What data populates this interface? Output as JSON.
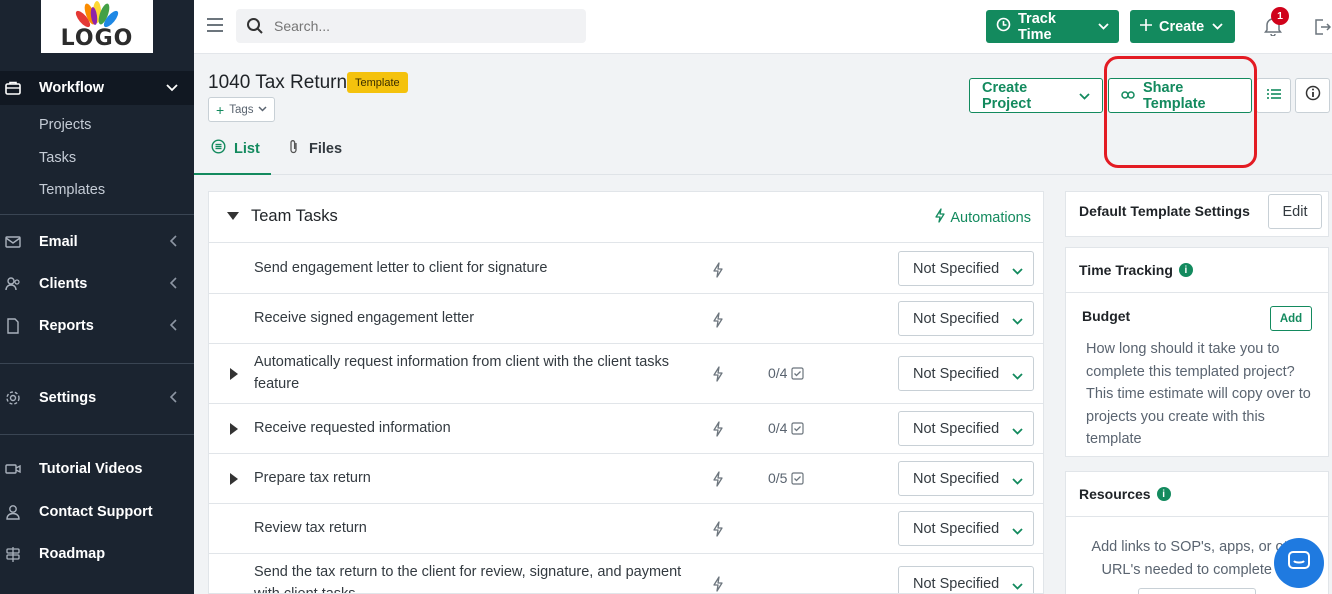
{
  "logo": {
    "text": "LOGO",
    "colors": [
      "#e53935",
      "#fb8c00",
      "#fdd835",
      "#43a047",
      "#1e88e5",
      "#8e24aa"
    ]
  },
  "sidebar": {
    "workflow": {
      "label": "Workflow",
      "icon": "briefcase-icon",
      "sub": [
        "Projects",
        "Tasks",
        "Templates"
      ]
    },
    "email": {
      "label": "Email",
      "icon": "envelope-icon"
    },
    "clients": {
      "label": "Clients",
      "icon": "users-icon"
    },
    "reports": {
      "label": "Reports",
      "icon": "document-icon"
    },
    "settings": {
      "label": "Settings",
      "icon": "gear-icon"
    },
    "tutorials": {
      "label": "Tutorial Videos",
      "icon": "video-icon"
    },
    "support": {
      "label": "Contact Support",
      "icon": "person-icon"
    },
    "roadmap": {
      "label": "Roadmap",
      "icon": "signpost-icon"
    }
  },
  "topbar": {
    "search_placeholder": "Search...",
    "track_time": "Track Time",
    "create": "Create",
    "notification_count": "1"
  },
  "header": {
    "title": "1040 Tax Return",
    "badge": "Template",
    "tags": "Tags",
    "create_project": "Create Project",
    "share_template": "Share Template"
  },
  "tabs": {
    "list": "List",
    "files": "Files"
  },
  "team_tasks": {
    "title": "Team Tasks",
    "automations": "Automations",
    "rows": [
      {
        "text": "Send engagement letter to client for signature",
        "count": "",
        "status": "Not Specified"
      },
      {
        "text": "Receive signed engagement letter",
        "count": "",
        "status": "Not Specified"
      },
      {
        "text": "Automatically request information from client with the client tasks feature",
        "count": "0/4",
        "status": "Not Specified"
      },
      {
        "text": "Receive requested information",
        "count": "0/4",
        "status": "Not Specified"
      },
      {
        "text": "Prepare tax return",
        "count": "0/5",
        "status": "Not Specified"
      },
      {
        "text": "Review tax return",
        "count": "",
        "status": "Not Specified"
      },
      {
        "text": "Send the tax return to the client for review, signature, and payment with client tasks",
        "count": "",
        "status": "Not Specified"
      }
    ]
  },
  "right": {
    "settings_title": "Default Template Settings",
    "edit": "Edit",
    "time_tracking": "Time Tracking",
    "budget": "Budget",
    "add": "Add",
    "budget_desc": "How long should it take you to complete this templated project? This time estimate will copy over to projects you create with this template",
    "resources": "Resources",
    "resources_desc": "Add links to SOP's, apps, or other URL's needed to complete this"
  },
  "colors": {
    "accent": "#138a5e",
    "sidebar": "#1b2430",
    "highlight": "#e31b23",
    "badge": "#f4c20d",
    "chat": "#1f7ae0"
  }
}
